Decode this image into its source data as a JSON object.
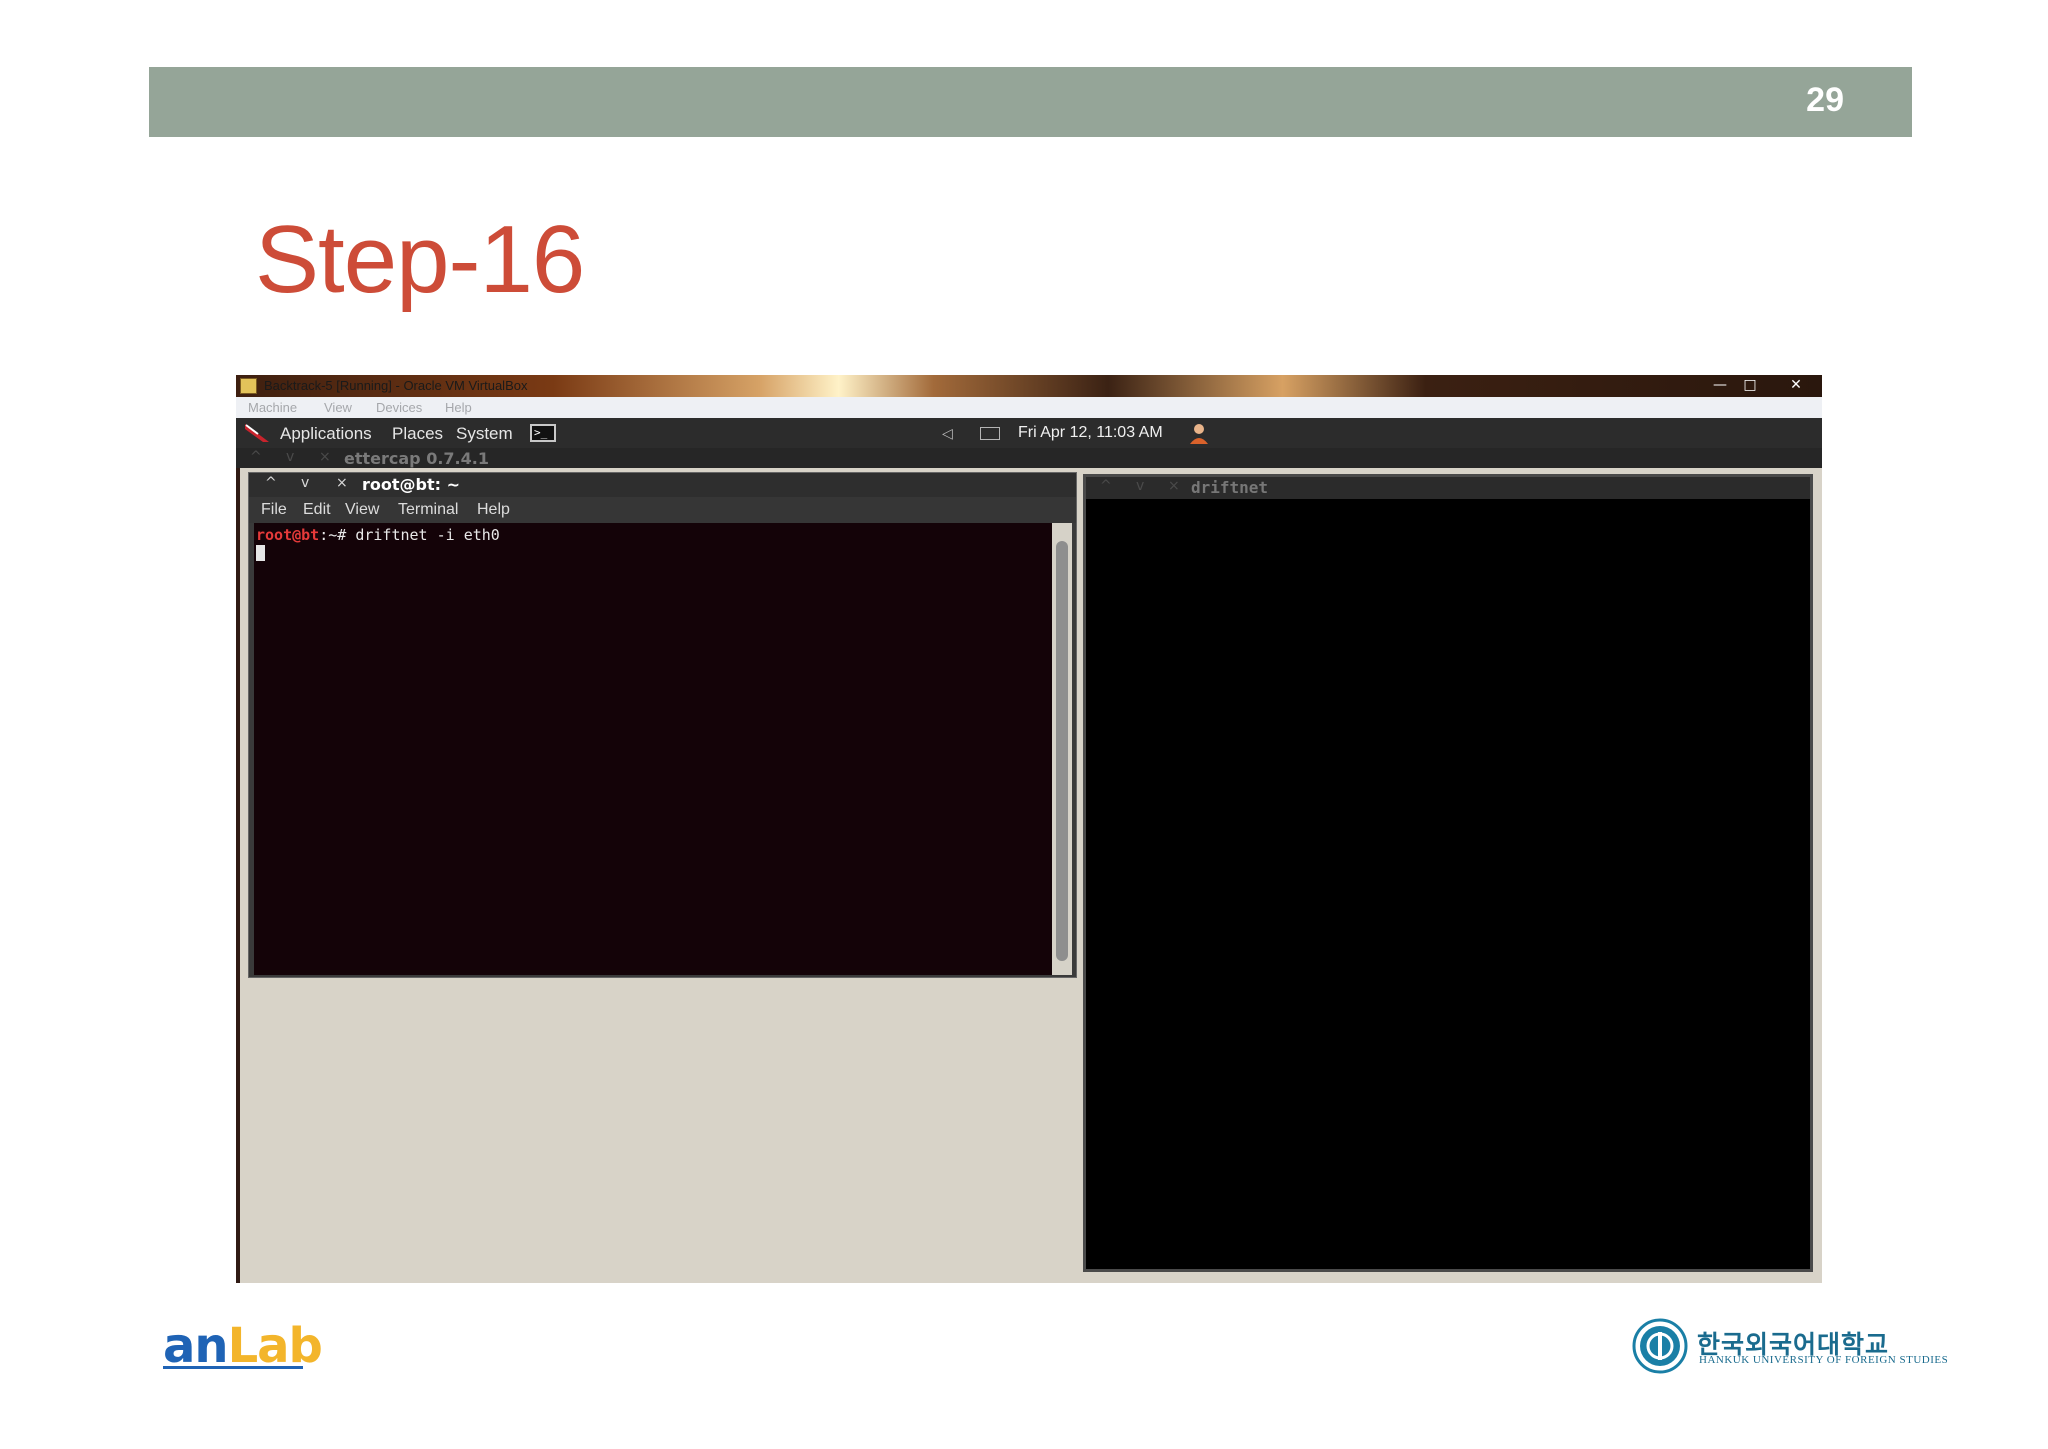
{
  "slide": {
    "page_number": "29",
    "title": "Step-16"
  },
  "vm_window": {
    "title": "Backtrack-5 [Running] - Oracle VM VirtualBox",
    "controls": {
      "minimize": "—",
      "restore": "□",
      "close": "✕"
    },
    "menu": [
      "Machine",
      "View",
      "Devices",
      "Help"
    ]
  },
  "gnome_panel": {
    "menus": [
      "Applications",
      "Places",
      "System"
    ],
    "clock": "Fri Apr 12, 11:03 AM",
    "terminal_icon_glyph": ">_"
  },
  "ettercap_window": {
    "title": "ettercap 0.7.4.1",
    "controls": [
      "^",
      "v",
      "×"
    ]
  },
  "terminal_window": {
    "title": "root@bt: ~",
    "controls": [
      "^",
      "v",
      "×"
    ],
    "menu": [
      "File",
      "Edit",
      "View",
      "Terminal",
      "Help"
    ],
    "prompt_userhost": "root@bt",
    "prompt_rest": ":~# ",
    "command": "driftnet -i eth0"
  },
  "driftnet_window": {
    "title": "driftnet",
    "controls": [
      "^",
      "v",
      "×"
    ]
  },
  "footer": {
    "anlab_an": "an",
    "anlab_lab": "Lab",
    "hufs_korean": "한국외국어대학교",
    "hufs_english": "HANKUK UNIVERSITY OF FOREIGN STUDIES"
  },
  "colors": {
    "header_bar": "#95a598",
    "title_red": "#cd4c38",
    "terminal_bg": "#140308",
    "prompt_red": "#e63a3a"
  }
}
